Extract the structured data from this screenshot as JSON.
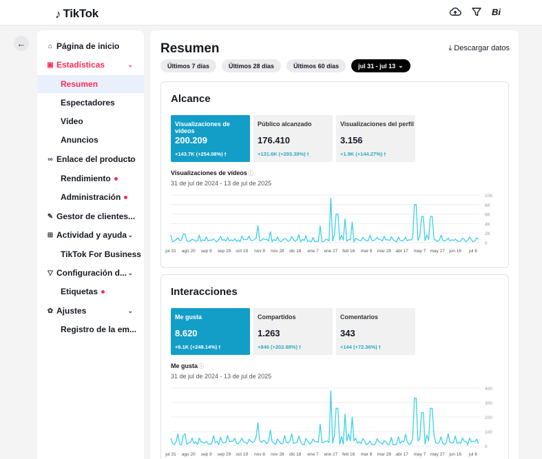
{
  "brand": {
    "name": "TikTok",
    "avatar_text": "Bi"
  },
  "icons": {
    "upload": "upload-cloud-icon",
    "filter": "filter-funnel-icon",
    "back": "arrow-left-icon"
  },
  "colors": {
    "accent": "#fe2c55",
    "chart": "#3ad0ea",
    "tile_active": "#139ec7",
    "delta": "#2ea7c3"
  },
  "sidebar": {
    "items": [
      {
        "label": "Página de inicio",
        "icon": "home-icon",
        "glyph": "⌂",
        "type": "top"
      },
      {
        "label": "Estadísticas",
        "icon": "chart-icon",
        "glyph": "▣",
        "type": "top",
        "chevron": true,
        "active": true
      },
      {
        "label": "Resumen",
        "type": "sub",
        "selected": true
      },
      {
        "label": "Espectadores",
        "type": "sub"
      },
      {
        "label": "Vídeo",
        "type": "sub"
      },
      {
        "label": "Anuncios",
        "type": "sub"
      },
      {
        "label": "Enlace del producto",
        "icon": "link-icon",
        "glyph": "∞",
        "type": "top",
        "chevron": true
      },
      {
        "label": "Rendimiento",
        "type": "sub",
        "dot": true
      },
      {
        "label": "Administración",
        "type": "sub",
        "dot": true
      },
      {
        "label": "Gestor de clientes...",
        "icon": "edit-icon",
        "glyph": "✎",
        "type": "top"
      },
      {
        "label": "Actividad y ayuda",
        "icon": "grid-icon",
        "glyph": "⊞",
        "type": "top",
        "chevron": true
      },
      {
        "label": "TikTok For Business",
        "type": "sub"
      },
      {
        "label": "Configuración d...",
        "icon": "filter-icon",
        "glyph": "▽",
        "type": "top",
        "chevron": true
      },
      {
        "label": "Etiquetas",
        "type": "sub",
        "dot": true
      },
      {
        "label": "Ajustes",
        "icon": "gear-icon",
        "glyph": "✿",
        "type": "top",
        "chevron": true
      },
      {
        "label": "Registro de la em...",
        "type": "sub"
      }
    ]
  },
  "main": {
    "title": "Resumen",
    "download_label": "Descargar datos",
    "ranges": [
      {
        "label": "Últimos 7 días"
      },
      {
        "label": "Últimos 28 días"
      },
      {
        "label": "Últimos 60 días"
      },
      {
        "label": "jul 31 - jul 13",
        "active": true
      }
    ]
  },
  "sections": [
    {
      "title": "Alcance",
      "tiles": [
        {
          "label": "Visualizaciones de vídeos",
          "value": "200.209",
          "delta": "+143.7K (+254.08%)",
          "active": true
        },
        {
          "label": "Público alcanzado",
          "value": "176.410",
          "delta": "+131.6K (+293.39%)"
        },
        {
          "label": "Visualizaciones del perfil",
          "value": "3.156",
          "delta": "+1.9K (+144.27%)"
        }
      ],
      "chart_label": "Visualizaciones de vídeos",
      "date_range": "31 de jul de 2024 - 13 de jul de 2025"
    },
    {
      "title": "Interacciones",
      "tiles": [
        {
          "label": "Me gusta",
          "value": "8.620",
          "delta": "+6.1K (+248.14%)",
          "active": true
        },
        {
          "label": "Compartidos",
          "value": "1.263",
          "delta": "+846 (+202.88%)"
        },
        {
          "label": "Comentarios",
          "value": "343",
          "delta": "+144 (+72.36%)"
        }
      ],
      "chart_label": "Me gusta",
      "date_range": "31 de jul de 2024 - 13 de jul de 2025"
    }
  ],
  "chart_data": [
    {
      "type": "line",
      "x_ticks": [
        "jul 31",
        "ago 20",
        "sep 9",
        "sep 29",
        "oct 19",
        "nov 8",
        "nov 28",
        "dic 18",
        "ene 7",
        "ene 27",
        "feb 16",
        "mar 8",
        "mar 28",
        "abr 17",
        "may 7",
        "may 27",
        "jun 16",
        "jul 6"
      ],
      "y_ticks": [
        "10K",
        "8K",
        "6K",
        "4K",
        "2K",
        "0"
      ],
      "ylim": [
        0,
        10000
      ],
      "peaks": [
        {
          "x": "ago 15",
          "y": 1800
        },
        {
          "x": "nov 6",
          "y": 3600
        },
        {
          "x": "nov 20",
          "y": 2300
        },
        {
          "x": "ene 15",
          "y": 3500
        },
        {
          "x": "ene 27",
          "y": 9300
        },
        {
          "x": "feb 3",
          "y": 6000
        },
        {
          "x": "feb 12",
          "y": 5000
        },
        {
          "x": "feb 20",
          "y": 4300
        },
        {
          "x": "may 2",
          "y": 8000
        },
        {
          "x": "may 10",
          "y": 5500
        },
        {
          "x": "may 20",
          "y": 5500
        }
      ],
      "baseline": 500
    },
    {
      "type": "line",
      "x_ticks": [
        "jul 31",
        "ago 20",
        "sep 9",
        "sep 29",
        "oct 19",
        "nov 8",
        "nov 28",
        "dic 18",
        "ene 7",
        "ene 27",
        "feb 16",
        "mar 8",
        "mar 28",
        "abr 17",
        "may 7",
        "may 27",
        "jun 16",
        "jul 6"
      ],
      "y_ticks": [
        "400",
        "300",
        "200",
        "100",
        "0"
      ],
      "ylim": [
        0,
        400
      ],
      "peaks": [
        {
          "x": "ago 15",
          "y": 70
        },
        {
          "x": "nov 6",
          "y": 160
        },
        {
          "x": "nov 20",
          "y": 110
        },
        {
          "x": "ene 15",
          "y": 150
        },
        {
          "x": "ene 27",
          "y": 380
        },
        {
          "x": "feb 3",
          "y": 260
        },
        {
          "x": "feb 12",
          "y": 220
        },
        {
          "x": "feb 20",
          "y": 200
        },
        {
          "x": "may 2",
          "y": 330
        },
        {
          "x": "may 10",
          "y": 230
        },
        {
          "x": "may 20",
          "y": 260
        }
      ],
      "baseline": 25
    }
  ]
}
